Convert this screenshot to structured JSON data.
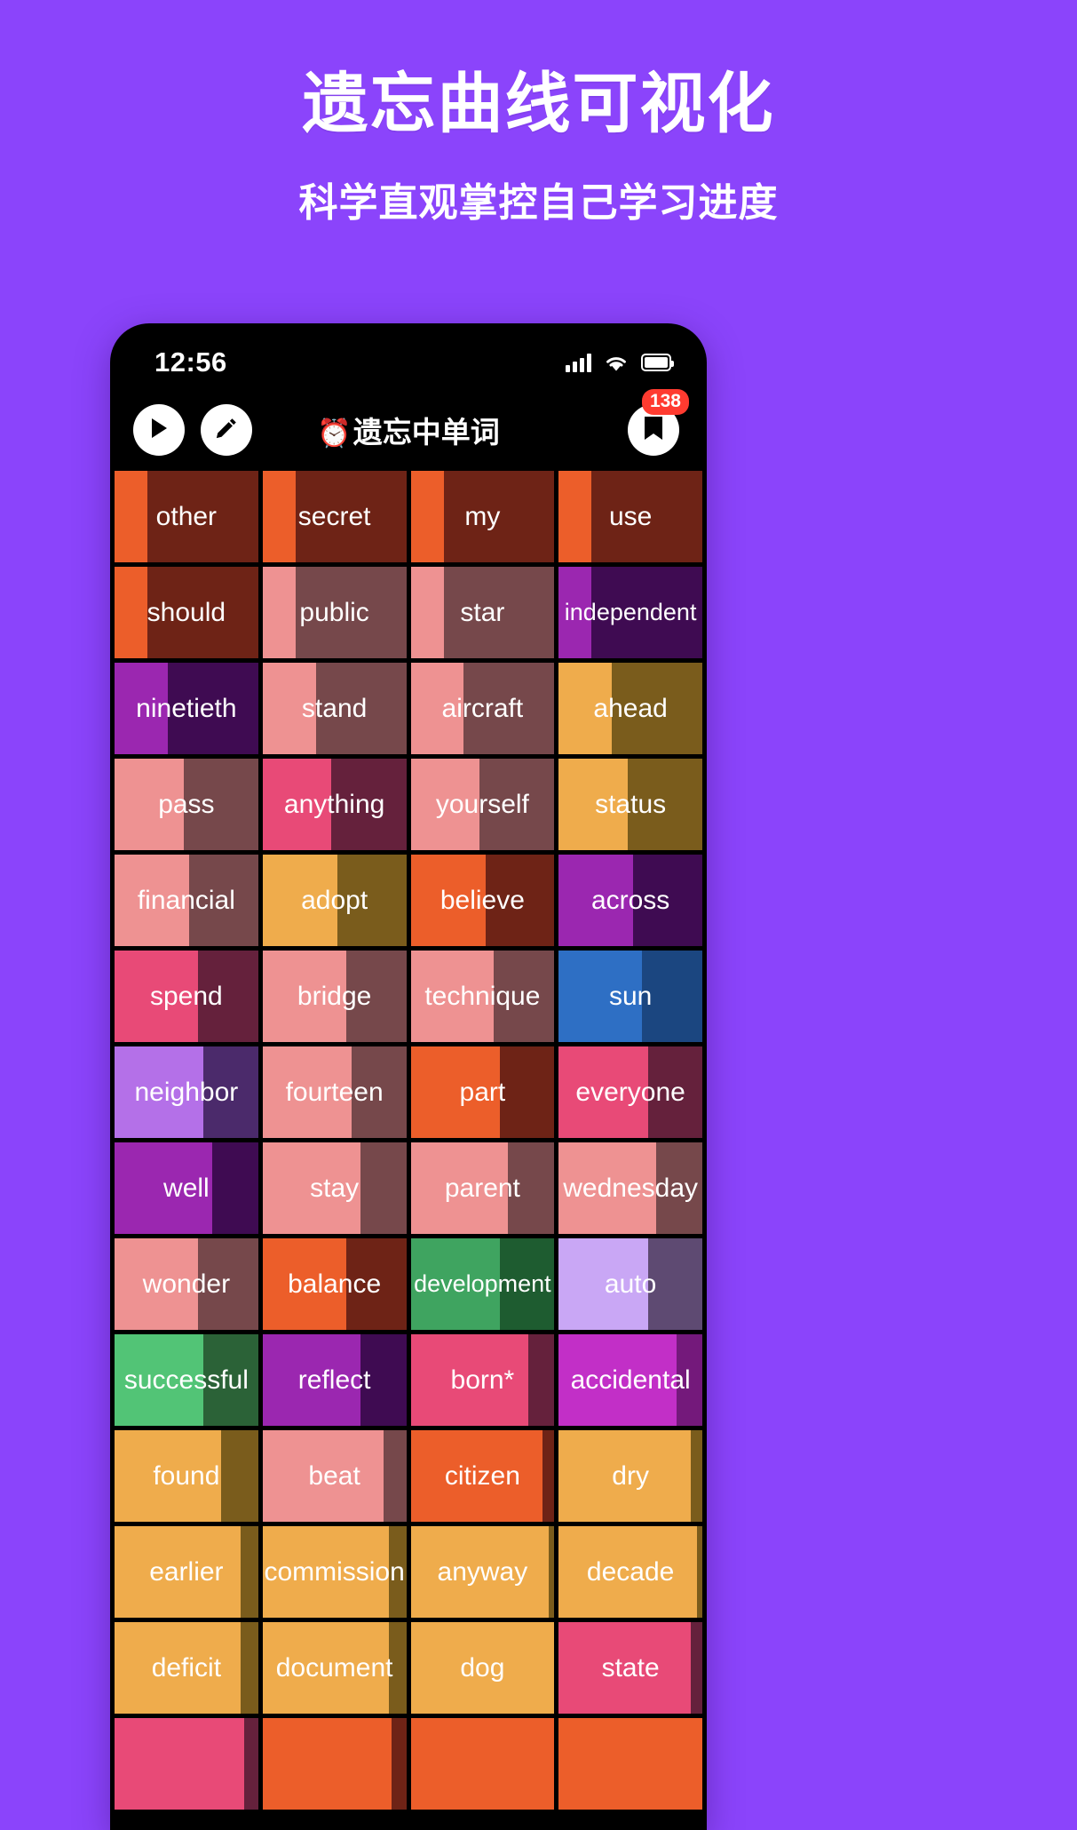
{
  "promo": {
    "title": "遗忘曲线可视化",
    "subtitle": "科学直观掌控自己学习进度",
    "background_color": "#8B44FB",
    "text_color": "#FFFFFF"
  },
  "phone": {
    "statusbar": {
      "time": "12:56",
      "signal_icon": "cellular-signal-icon",
      "wifi_icon": "wifi-icon",
      "battery_icon": "battery-full-icon"
    },
    "appbar": {
      "play_button_label": "play-icon",
      "edit_button_label": "pencil-icon",
      "title_emoji": "⏰",
      "title": "遗忘中单词",
      "book_button_label": "book-icon",
      "badge_count": "138",
      "badge_color": "#FF3B30"
    }
  },
  "grid": {
    "columns": 4,
    "cells": [
      {
        "word": "other",
        "bar_color": "#EC5E2A",
        "bg_color": "#6E2316",
        "percent": 23
      },
      {
        "word": "secret",
        "bar_color": "#EC5E2A",
        "bg_color": "#6E2316",
        "percent": 23
      },
      {
        "word": "my",
        "bar_color": "#EC5E2A",
        "bg_color": "#6E2316",
        "percent": 23
      },
      {
        "word": "use",
        "bar_color": "#EC5E2A",
        "bg_color": "#6E2316",
        "percent": 23
      },
      {
        "word": "should",
        "bar_color": "#EC5E2A",
        "bg_color": "#6E2316",
        "percent": 23
      },
      {
        "word": "public",
        "bar_color": "#EE9292",
        "bg_color": "#76484B",
        "percent": 23
      },
      {
        "word": "star",
        "bar_color": "#EE9292",
        "bg_color": "#76484B",
        "percent": 23
      },
      {
        "word": "independent",
        "bar_color": "#9B27B0",
        "bg_color": "#3F0B52",
        "percent": 23
      },
      {
        "word": "ninetieth",
        "bar_color": "#9B27B0",
        "bg_color": "#3F0B52",
        "percent": 37
      },
      {
        "word": "stand",
        "bar_color": "#EE9292",
        "bg_color": "#76484B",
        "percent": 37
      },
      {
        "word": "aircraft",
        "bar_color": "#EE9292",
        "bg_color": "#76484B",
        "percent": 37
      },
      {
        "word": "ahead",
        "bar_color": "#EFAC4C",
        "bg_color": "#7A5C1C",
        "percent": 37
      },
      {
        "word": "pass",
        "bar_color": "#EE9292",
        "bg_color": "#76484B",
        "percent": 48
      },
      {
        "word": "anything",
        "bar_color": "#E84A77",
        "bg_color": "#65213C",
        "percent": 48
      },
      {
        "word": "yourself",
        "bar_color": "#EE9292",
        "bg_color": "#76484B",
        "percent": 48
      },
      {
        "word": "status",
        "bar_color": "#EFAC4C",
        "bg_color": "#7A5C1C",
        "percent": 48
      },
      {
        "word": "financial",
        "bar_color": "#EE9292",
        "bg_color": "#76484B",
        "percent": 52
      },
      {
        "word": "adopt",
        "bar_color": "#EFAC4C",
        "bg_color": "#7A5C1C",
        "percent": 52
      },
      {
        "word": "believe",
        "bar_color": "#EC5E2A",
        "bg_color": "#6E2316",
        "percent": 52
      },
      {
        "word": "across",
        "bar_color": "#9B27B0",
        "bg_color": "#3F0B52",
        "percent": 52
      },
      {
        "word": "spend",
        "bar_color": "#E84A77",
        "bg_color": "#65213C",
        "percent": 58
      },
      {
        "word": "bridge",
        "bar_color": "#EE9292",
        "bg_color": "#76484B",
        "percent": 58
      },
      {
        "word": "technique",
        "bar_color": "#EE9292",
        "bg_color": "#76484B",
        "percent": 58
      },
      {
        "word": "sun",
        "bar_color": "#2E6FC4",
        "bg_color": "#1B4680",
        "percent": 58
      },
      {
        "word": "neighbor",
        "bar_color": "#B470E8",
        "bg_color": "#4B2A6B",
        "percent": 62
      },
      {
        "word": "fourteen",
        "bar_color": "#EE9292",
        "bg_color": "#76484B",
        "percent": 62
      },
      {
        "word": "part",
        "bar_color": "#EC5E2A",
        "bg_color": "#6E2316",
        "percent": 62
      },
      {
        "word": "everyone",
        "bar_color": "#E84A77",
        "bg_color": "#65213C",
        "percent": 62
      },
      {
        "word": "well",
        "bar_color": "#9B27B0",
        "bg_color": "#3F0B52",
        "percent": 68
      },
      {
        "word": "stay",
        "bar_color": "#EE9292",
        "bg_color": "#76484B",
        "percent": 68
      },
      {
        "word": "parent",
        "bar_color": "#EE9292",
        "bg_color": "#76484B",
        "percent": 68
      },
      {
        "word": "wednesday",
        "bar_color": "#EE9292",
        "bg_color": "#76484B",
        "percent": 68
      },
      {
        "word": "wonder",
        "bar_color": "#EE9292",
        "bg_color": "#76484B",
        "percent": 58
      },
      {
        "word": "balance",
        "bar_color": "#EC5E2A",
        "bg_color": "#6E2316",
        "percent": 58
      },
      {
        "word": "development",
        "bar_color": "#3FA460",
        "bg_color": "#1E5C30",
        "percent": 62
      },
      {
        "word": "auto",
        "bar_color": "#C9A7F5",
        "bg_color": "#5E4A72",
        "percent": 62
      },
      {
        "word": "successful",
        "bar_color": "#52C476",
        "bg_color": "#2B6237",
        "percent": 62
      },
      {
        "word": "reflect",
        "bar_color": "#9B27B0",
        "bg_color": "#3F0B52",
        "percent": 68
      },
      {
        "word": "born*",
        "bar_color": "#E84A77",
        "bg_color": "#65213C",
        "percent": 82
      },
      {
        "word": "accidental",
        "bar_color": "#C22FC7",
        "bg_color": "#74197B",
        "percent": 82
      },
      {
        "word": "found",
        "bar_color": "#EFAC4C",
        "bg_color": "#7A5C1C",
        "percent": 74
      },
      {
        "word": "beat",
        "bar_color": "#EE9292",
        "bg_color": "#76484B",
        "percent": 84
      },
      {
        "word": "citizen",
        "bar_color": "#EC5E2A",
        "bg_color": "#6E2316",
        "percent": 92
      },
      {
        "word": "dry",
        "bar_color": "#EFAC4C",
        "bg_color": "#7A5C1C",
        "percent": 92
      },
      {
        "word": "earlier",
        "bar_color": "#EFAC4C",
        "bg_color": "#7A5C1C",
        "percent": 88
      },
      {
        "word": "commission",
        "bar_color": "#EFAC4C",
        "bg_color": "#7A5C1C",
        "percent": 88
      },
      {
        "word": "anyway",
        "bar_color": "#EFAC4C",
        "bg_color": "#7A5C1C",
        "percent": 96
      },
      {
        "word": "decade",
        "bar_color": "#EFAC4C",
        "bg_color": "#7A5C1C",
        "percent": 96
      },
      {
        "word": "deficit",
        "bar_color": "#EFAC4C",
        "bg_color": "#7A5C1C",
        "percent": 88
      },
      {
        "word": "document",
        "bar_color": "#EFAC4C",
        "bg_color": "#7A5C1C",
        "percent": 88
      },
      {
        "word": "dog",
        "bar_color": "#EFAC4C",
        "bg_color": "#7A5C1C",
        "percent": 100
      },
      {
        "word": "state",
        "bar_color": "#E84A77",
        "bg_color": "#65213C",
        "percent": 92
      },
      {
        "word": "",
        "bar_color": "#E84A77",
        "bg_color": "#65213C",
        "percent": 90
      },
      {
        "word": "",
        "bar_color": "#EC5E2A",
        "bg_color": "#6E2316",
        "percent": 90
      },
      {
        "word": "",
        "bar_color": "#EC5E2A",
        "bg_color": "#6E2316",
        "percent": 100
      },
      {
        "word": "",
        "bar_color": "#EC5E2A",
        "bg_color": "#6E2316",
        "percent": 100
      }
    ]
  }
}
